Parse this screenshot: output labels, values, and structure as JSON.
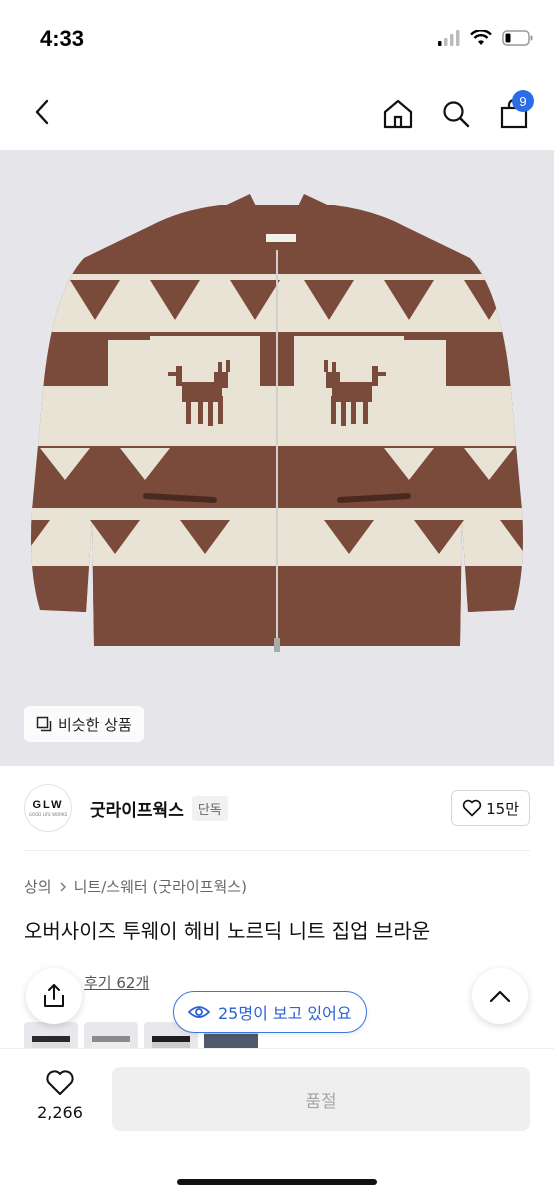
{
  "status_bar": {
    "time": "4:33"
  },
  "nav": {
    "cart_count": "9"
  },
  "product_image": {
    "similar_label": "비슷한 상품"
  },
  "brand": {
    "logo_text": "GLW",
    "logo_subtext": "GOOD LIFE WORKS",
    "name": "굿라이프웍스",
    "tag": "단독",
    "likes": "15만"
  },
  "breadcrumb": {
    "root": "상의",
    "category": "니트/스웨터 (굿라이프웍스)"
  },
  "product": {
    "title": "오버사이즈 투웨이 헤비 노르딕 니트 집업 브라운"
  },
  "reviews": {
    "label": "후기 62개"
  },
  "viewers": {
    "label": "25명이 보고 있어요"
  },
  "bottom": {
    "wish_count": "2,266",
    "buy_label": "품절"
  },
  "colors": {
    "accent": "#2b6de6",
    "sweater_brown": "#7a4a3a",
    "sweater_cream": "#e9e3d6"
  }
}
